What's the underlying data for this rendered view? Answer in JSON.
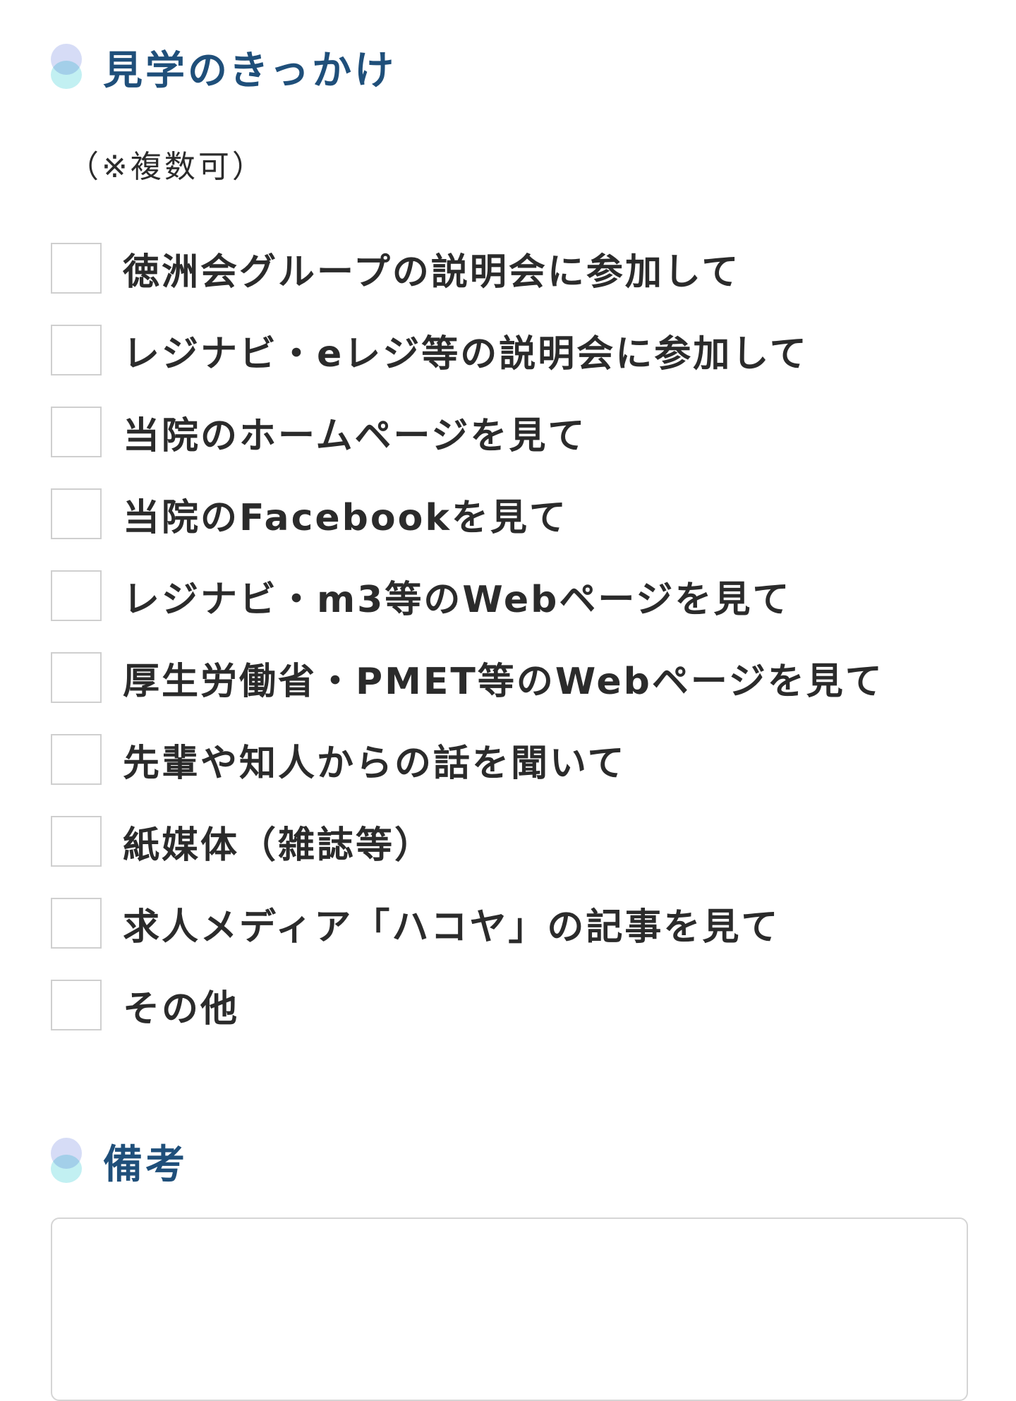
{
  "sections": {
    "kikkake": {
      "title": "見学のきっかけ",
      "note": "（※複数可）",
      "options": [
        {
          "label": "徳洲会グループの説明会に参加して",
          "checked": false
        },
        {
          "label": "レジナビ・eレジ等の説明会に参加して",
          "checked": false
        },
        {
          "label": "当院のホームページを見て",
          "checked": false
        },
        {
          "label": "当院のFacebookを見て",
          "checked": false
        },
        {
          "label": "レジナビ・m3等のWebページを見て",
          "checked": false
        },
        {
          "label": "厚生労働省・PMET等のWebページを見て",
          "checked": false
        },
        {
          "label": "先輩や知人からの話を聞いて",
          "checked": false
        },
        {
          "label": "紙媒体（雑誌等）",
          "checked": false
        },
        {
          "label": "求人メディア「ハコヤ」の記事を見て",
          "checked": false
        },
        {
          "label": "その他",
          "checked": false
        }
      ]
    },
    "biko": {
      "title": "備考",
      "value": ""
    }
  },
  "colors": {
    "title": "#1f4f7a",
    "mark_top": "#d6dcf6",
    "mark_bottom": "#c2f0f2",
    "checkbox_border": "#cfcfcf"
  }
}
